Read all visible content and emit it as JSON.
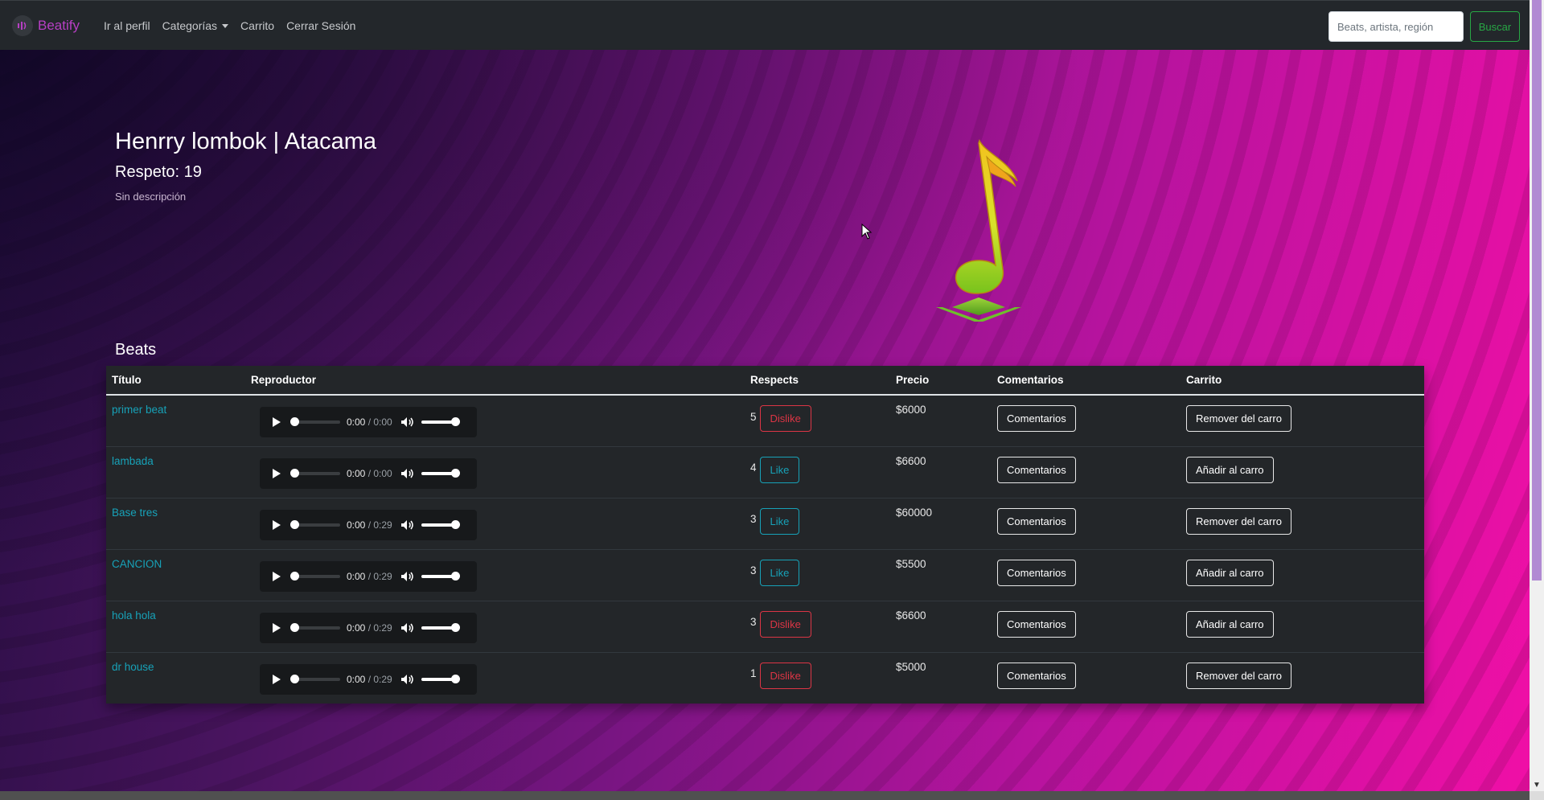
{
  "navbar": {
    "brand": "Beatify",
    "links": [
      "Ir al perfil",
      "Categorías",
      "Carrito",
      "Cerrar Sesión"
    ],
    "search_placeholder": "Beats, artista, región",
    "search_button": "Buscar"
  },
  "profile": {
    "name": "Henrry lombok | Atacama",
    "respect": "Respeto: 19",
    "description": "Sin descripción"
  },
  "beats": {
    "title": "Beats",
    "columns": [
      "Título",
      "Reproductor",
      "Respects",
      "Precio",
      "Comentarios",
      "Carrito"
    ],
    "rows": [
      {
        "title": "primer beat",
        "time_current": "0:00",
        "time_total": "0:00",
        "respects": "5",
        "vote": "Dislike",
        "price": "$6000",
        "comments": "Comentarios",
        "cart": "Remover del carro"
      },
      {
        "title": "lambada",
        "time_current": "0:00",
        "time_total": "0:00",
        "respects": "4",
        "vote": "Like",
        "price": "$6600",
        "comments": "Comentarios",
        "cart": "Añadir al carro"
      },
      {
        "title": "Base tres",
        "time_current": "0:00",
        "time_total": "0:29",
        "respects": "3",
        "vote": "Like",
        "price": "$60000",
        "comments": "Comentarios",
        "cart": "Remover del carro"
      },
      {
        "title": "CANCION",
        "time_current": "0:00",
        "time_total": "0:29",
        "respects": "3",
        "vote": "Like",
        "price": "$5500",
        "comments": "Comentarios",
        "cart": "Añadir al carro"
      },
      {
        "title": "hola hola",
        "time_current": "0:00",
        "time_total": "0:29",
        "respects": "3",
        "vote": "Dislike",
        "price": "$6600",
        "comments": "Comentarios",
        "cart": "Añadir al carro"
      },
      {
        "title": "dr house",
        "time_current": "0:00",
        "time_total": "0:29",
        "respects": "1",
        "vote": "Dislike",
        "price": "$5000",
        "comments": "Comentarios",
        "cart": "Remover del carro"
      }
    ]
  },
  "colors": {
    "brand": "#b73fc4",
    "link": "#17a2b8",
    "like": "#17a2b8",
    "dislike": "#dc3545",
    "search_button": "#28a745"
  }
}
